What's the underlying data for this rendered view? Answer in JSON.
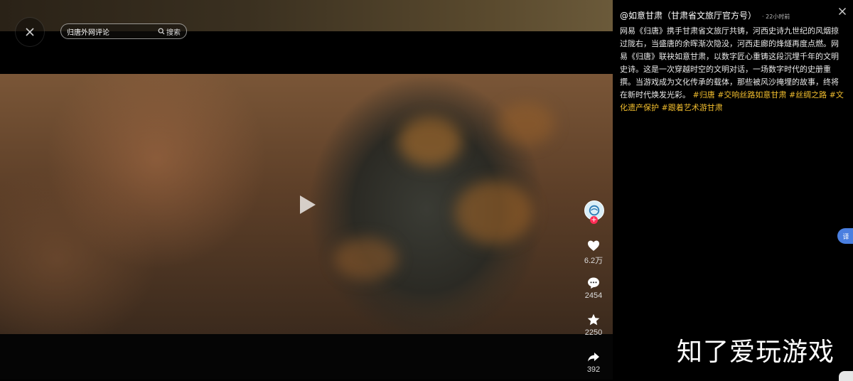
{
  "player": {
    "search": {
      "value": "归唐外网评论",
      "button_label": "搜索"
    },
    "actions": {
      "likes": "6.2万",
      "comments": "2454",
      "favorites": "2250",
      "shares": "392"
    }
  },
  "post": {
    "author": "@如意甘肃（甘肃省文旅厅官方号）",
    "time": "· 22小时前",
    "description": "网易《归唐》携手甘肃省文旅厅共铸，河西史诗九世纪的风烟掠过陇右，当盛唐的余晖渐次隐没，河西走廊的烽燧再度点燃。网易《归唐》联袂如意甘肃，以数字匠心重铸这段沉埋千年的文明史诗。这是一次穿越时空的文明对话，一场数字时代的史册重撰。当游戏成为文化传承的载体，那些被风沙掩埋的故事，终将在新时代焕发光彩。",
    "tags": [
      "#归唐",
      "#交响丝路如意甘肃",
      "#丝绸之路",
      "#文化遗产保护",
      "#跟着艺术游甘肃"
    ]
  },
  "overlay": {
    "translate_label": "译",
    "watermark": "知了爱玩游戏"
  },
  "colors": {
    "tag": "#f3bf2e",
    "like_badge": "#fe2c55",
    "translate_tab": "#4a7fe0"
  }
}
